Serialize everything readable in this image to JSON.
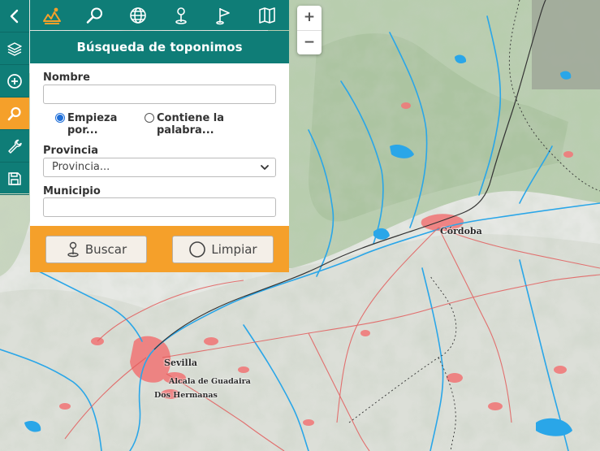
{
  "map": {
    "labels": {
      "cordoba": "Córdoba",
      "sevilla": "Sevilla",
      "alcala": "Alcala de Guadaira",
      "dos_hermanas": "Dos Hermanas"
    }
  },
  "zoom": {
    "in_label": "+",
    "out_label": "−"
  },
  "rail": {
    "items": [
      {
        "icon": "chevron-left-icon"
      },
      {
        "icon": "layers-icon"
      },
      {
        "icon": "plus-circle-icon"
      },
      {
        "icon": "search-icon",
        "active": true
      },
      {
        "icon": "wrench-icon"
      },
      {
        "icon": "save-icon"
      }
    ]
  },
  "tabs": [
    {
      "icon": "toponym-icon",
      "active": true
    },
    {
      "icon": "search-icon"
    },
    {
      "icon": "globe-icon"
    },
    {
      "icon": "map-pin-icon"
    },
    {
      "icon": "flag-icon"
    },
    {
      "icon": "map-book-icon"
    }
  ],
  "panel": {
    "title": "Búsqueda de toponimos",
    "nombre_label": "Nombre",
    "nombre_value": "",
    "radio_starts_with_1": "Empieza",
    "radio_starts_with_2": "por...",
    "radio_contains_1": "Contiene la",
    "radio_contains_2": "palabra...",
    "selected_mode": "starts_with",
    "provincia_label": "Provincia",
    "provincia_selected": "Provincia...",
    "municipio_label": "Municipio",
    "municipio_value": "",
    "buscar_label": "Buscar",
    "limpiar_label": "Limpiar"
  },
  "colors": {
    "teal": "#0f7d77",
    "orange": "#f5a02a",
    "river": "#2aa6e8",
    "urban": "#f07a7a"
  }
}
